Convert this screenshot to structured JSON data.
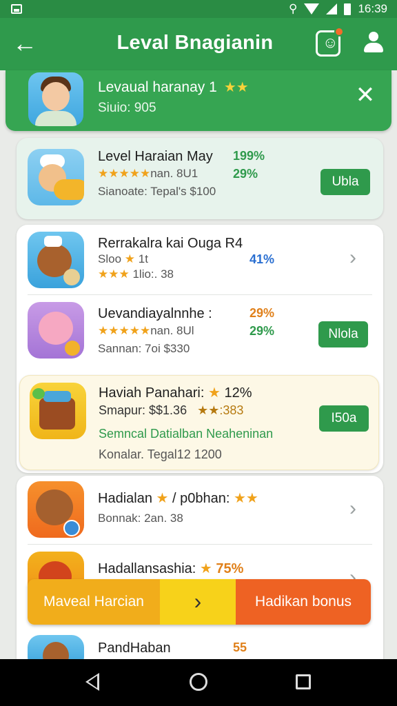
{
  "status_bar": {
    "time": "16:39"
  },
  "app_bar": {
    "title": "Leval Bnagianin"
  },
  "user_banner": {
    "name": "Levaual haranay 1",
    "stars": "★★",
    "subtitle": "Siuio: 905"
  },
  "featured": {
    "title": "Level Haraian May",
    "percent_1": "199%",
    "line_1_stars": "★★★★★",
    "line_1_text": "nan. 8U1",
    "percent_2": "29%",
    "line_2": "Sianoate: Tepal's $100",
    "button_label": "Ubla"
  },
  "list": [
    {
      "title": "Rerrakalra kai Ouga R4",
      "line_1_text": "Sloo",
      "line_1_stars": "★",
      "line_1_suffix": "1t",
      "percent": "41%",
      "line_2_stars": "★★★",
      "line_2_text": "1lio:. 38"
    },
    {
      "title": "Uevandiayalnnhe :",
      "percent_1": "29%",
      "line_1_stars": "★★★★★",
      "line_1_text": "nan. 8Ul",
      "percent_2": "29%",
      "line_2": "Sannan: 7oi $330",
      "button_label": "Nlola"
    }
  ],
  "highlight": {
    "title": "Haviah Panahari:",
    "title_stars": "★",
    "title_percent": "12%",
    "line_1": "Smapur: $$1.36",
    "line_1_suffix": "★★:383",
    "line_2": "Semncal Datialban Neaheninan",
    "line_3": "Konalar. Tegal12 1200",
    "button_label": "I50a"
  },
  "list_2": [
    {
      "title": "Hadialan",
      "title_stars": "★",
      "title_suffix": "/ p0bhan:",
      "title_stars_2": "★★",
      "line_1": "Bonnak: 2an. 38"
    },
    {
      "title": "Hadallansashia:",
      "title_stars": "★",
      "percent": "75%"
    },
    {
      "title": "PandHaban",
      "percent": "55"
    }
  ],
  "action_bar": {
    "left_label": "Maveal Harcian",
    "middle_label": "›",
    "right_label": "Hadikan bonus"
  },
  "colors": {
    "primary_green": "#2f9a4c",
    "amber": "#f1ad1b",
    "yellow": "#f7d21a",
    "orange": "#ee6223"
  }
}
